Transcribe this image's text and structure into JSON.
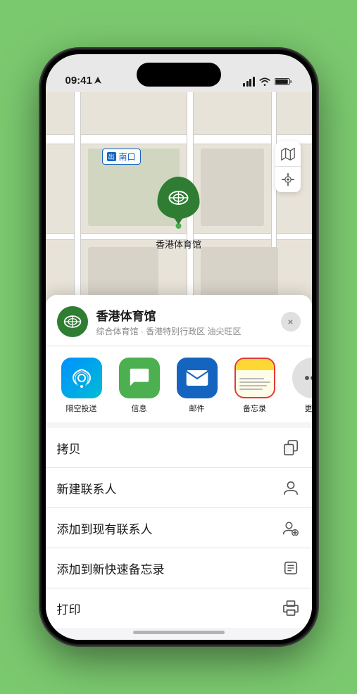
{
  "status_bar": {
    "time": "09:41",
    "location_arrow": "▶"
  },
  "map": {
    "label_text": "南口",
    "stadium_name": "香港体育馆",
    "map_icon": "🗺",
    "location_icon": "⊕"
  },
  "sheet": {
    "venue_name": "香港体育馆",
    "venue_subtitle": "综合体育馆 · 香港特别行政区 油尖旺区",
    "close_label": "×"
  },
  "share_items": [
    {
      "label": "隔空投送",
      "type": "airdrop"
    },
    {
      "label": "信息",
      "type": "messages"
    },
    {
      "label": "邮件",
      "type": "mail"
    },
    {
      "label": "备忘录",
      "type": "notes"
    }
  ],
  "action_items": [
    {
      "label": "拷贝",
      "icon": "copy"
    },
    {
      "label": "新建联系人",
      "icon": "person-add"
    },
    {
      "label": "添加到现有联系人",
      "icon": "person-badge-plus"
    },
    {
      "label": "添加到新快速备忘录",
      "icon": "note-add"
    },
    {
      "label": "打印",
      "icon": "printer"
    }
  ]
}
